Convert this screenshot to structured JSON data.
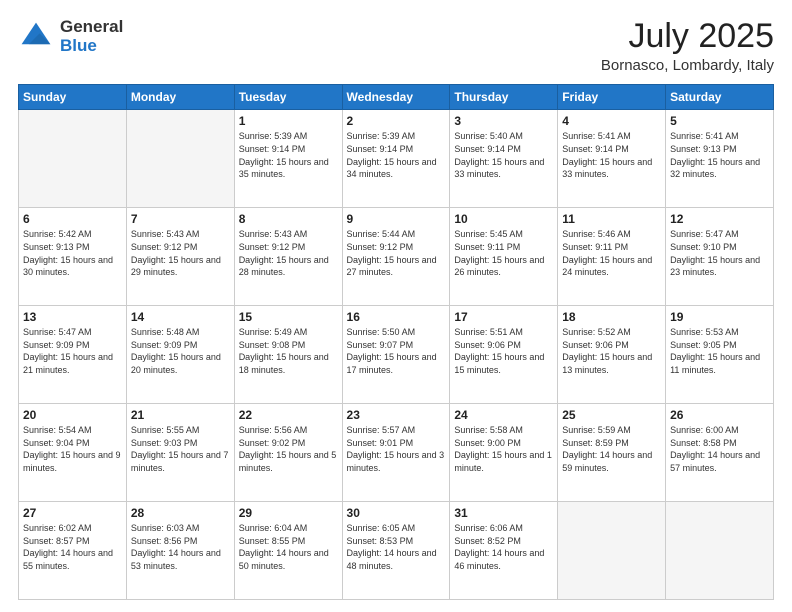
{
  "header": {
    "logo_general": "General",
    "logo_blue": "Blue",
    "month": "July 2025",
    "location": "Bornasco, Lombardy, Italy"
  },
  "days_of_week": [
    "Sunday",
    "Monday",
    "Tuesday",
    "Wednesday",
    "Thursday",
    "Friday",
    "Saturday"
  ],
  "weeks": [
    [
      {
        "day": "",
        "info": ""
      },
      {
        "day": "",
        "info": ""
      },
      {
        "day": "1",
        "info": "Sunrise: 5:39 AM\nSunset: 9:14 PM\nDaylight: 15 hours and 35 minutes."
      },
      {
        "day": "2",
        "info": "Sunrise: 5:39 AM\nSunset: 9:14 PM\nDaylight: 15 hours and 34 minutes."
      },
      {
        "day": "3",
        "info": "Sunrise: 5:40 AM\nSunset: 9:14 PM\nDaylight: 15 hours and 33 minutes."
      },
      {
        "day": "4",
        "info": "Sunrise: 5:41 AM\nSunset: 9:14 PM\nDaylight: 15 hours and 33 minutes."
      },
      {
        "day": "5",
        "info": "Sunrise: 5:41 AM\nSunset: 9:13 PM\nDaylight: 15 hours and 32 minutes."
      }
    ],
    [
      {
        "day": "6",
        "info": "Sunrise: 5:42 AM\nSunset: 9:13 PM\nDaylight: 15 hours and 30 minutes."
      },
      {
        "day": "7",
        "info": "Sunrise: 5:43 AM\nSunset: 9:12 PM\nDaylight: 15 hours and 29 minutes."
      },
      {
        "day": "8",
        "info": "Sunrise: 5:43 AM\nSunset: 9:12 PM\nDaylight: 15 hours and 28 minutes."
      },
      {
        "day": "9",
        "info": "Sunrise: 5:44 AM\nSunset: 9:12 PM\nDaylight: 15 hours and 27 minutes."
      },
      {
        "day": "10",
        "info": "Sunrise: 5:45 AM\nSunset: 9:11 PM\nDaylight: 15 hours and 26 minutes."
      },
      {
        "day": "11",
        "info": "Sunrise: 5:46 AM\nSunset: 9:11 PM\nDaylight: 15 hours and 24 minutes."
      },
      {
        "day": "12",
        "info": "Sunrise: 5:47 AM\nSunset: 9:10 PM\nDaylight: 15 hours and 23 minutes."
      }
    ],
    [
      {
        "day": "13",
        "info": "Sunrise: 5:47 AM\nSunset: 9:09 PM\nDaylight: 15 hours and 21 minutes."
      },
      {
        "day": "14",
        "info": "Sunrise: 5:48 AM\nSunset: 9:09 PM\nDaylight: 15 hours and 20 minutes."
      },
      {
        "day": "15",
        "info": "Sunrise: 5:49 AM\nSunset: 9:08 PM\nDaylight: 15 hours and 18 minutes."
      },
      {
        "day": "16",
        "info": "Sunrise: 5:50 AM\nSunset: 9:07 PM\nDaylight: 15 hours and 17 minutes."
      },
      {
        "day": "17",
        "info": "Sunrise: 5:51 AM\nSunset: 9:06 PM\nDaylight: 15 hours and 15 minutes."
      },
      {
        "day": "18",
        "info": "Sunrise: 5:52 AM\nSunset: 9:06 PM\nDaylight: 15 hours and 13 minutes."
      },
      {
        "day": "19",
        "info": "Sunrise: 5:53 AM\nSunset: 9:05 PM\nDaylight: 15 hours and 11 minutes."
      }
    ],
    [
      {
        "day": "20",
        "info": "Sunrise: 5:54 AM\nSunset: 9:04 PM\nDaylight: 15 hours and 9 minutes."
      },
      {
        "day": "21",
        "info": "Sunrise: 5:55 AM\nSunset: 9:03 PM\nDaylight: 15 hours and 7 minutes."
      },
      {
        "day": "22",
        "info": "Sunrise: 5:56 AM\nSunset: 9:02 PM\nDaylight: 15 hours and 5 minutes."
      },
      {
        "day": "23",
        "info": "Sunrise: 5:57 AM\nSunset: 9:01 PM\nDaylight: 15 hours and 3 minutes."
      },
      {
        "day": "24",
        "info": "Sunrise: 5:58 AM\nSunset: 9:00 PM\nDaylight: 15 hours and 1 minute."
      },
      {
        "day": "25",
        "info": "Sunrise: 5:59 AM\nSunset: 8:59 PM\nDaylight: 14 hours and 59 minutes."
      },
      {
        "day": "26",
        "info": "Sunrise: 6:00 AM\nSunset: 8:58 PM\nDaylight: 14 hours and 57 minutes."
      }
    ],
    [
      {
        "day": "27",
        "info": "Sunrise: 6:02 AM\nSunset: 8:57 PM\nDaylight: 14 hours and 55 minutes."
      },
      {
        "day": "28",
        "info": "Sunrise: 6:03 AM\nSunset: 8:56 PM\nDaylight: 14 hours and 53 minutes."
      },
      {
        "day": "29",
        "info": "Sunrise: 6:04 AM\nSunset: 8:55 PM\nDaylight: 14 hours and 50 minutes."
      },
      {
        "day": "30",
        "info": "Sunrise: 6:05 AM\nSunset: 8:53 PM\nDaylight: 14 hours and 48 minutes."
      },
      {
        "day": "31",
        "info": "Sunrise: 6:06 AM\nSunset: 8:52 PM\nDaylight: 14 hours and 46 minutes."
      },
      {
        "day": "",
        "info": ""
      },
      {
        "day": "",
        "info": ""
      }
    ]
  ]
}
